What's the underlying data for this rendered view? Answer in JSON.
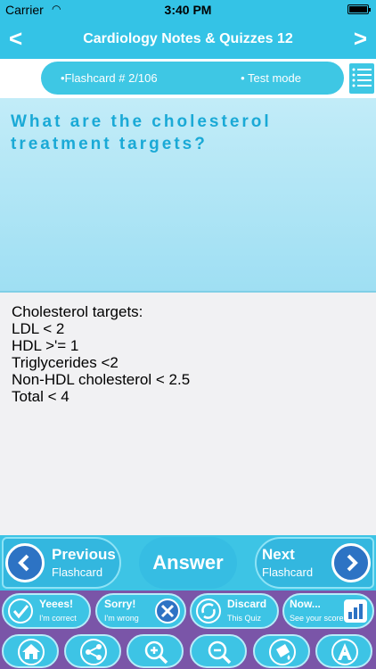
{
  "status_bar": {
    "carrier": "Carrier",
    "time": "3:40 PM"
  },
  "nav": {
    "back_glyph": "<",
    "forward_glyph": ">",
    "title": "Cardiology Notes & Quizzes 12"
  },
  "flashcard_strip": {
    "counter": "•Flashcard #  2/106",
    "mode": "• Test mode",
    "list_icon": "list-icon"
  },
  "question": {
    "text": "What are the cholesterol treatment targets?"
  },
  "answer": {
    "lines": [
      "Cholesterol targets:",
      "LDL < 2",
      "HDL >'= 1",
      "Triglycerides <2",
      "Non-HDL cholesterol < 2.5",
      "Total < 4"
    ]
  },
  "controls": {
    "previous": {
      "big": "Previous",
      "small": "Flashcard"
    },
    "answer": "Answer",
    "next": {
      "big": "Next",
      "small": "Flashcard"
    }
  },
  "score_buttons": [
    {
      "big": "Yeees!",
      "small": "I'm correct",
      "icon": "checkmark-icon"
    },
    {
      "big": "Sorry!",
      "small": "I'm wrong",
      "icon": "cross-icon"
    },
    {
      "big": "Discard",
      "small": "This Quiz",
      "icon": "recycle-icon"
    },
    {
      "big": "Now...",
      "small": "See your score",
      "icon": "bar-chart-icon"
    }
  ],
  "toolbar_icons": [
    "home-icon",
    "share-icon",
    "zoom-in-icon",
    "zoom-out-icon",
    "bucket-icon",
    "font-icon"
  ],
  "colors": {
    "accent": "#34c3e6",
    "question_text": "#1aa9d6",
    "bottom_bg": "#7a55a8",
    "arrow_circle": "#2d73c4"
  }
}
